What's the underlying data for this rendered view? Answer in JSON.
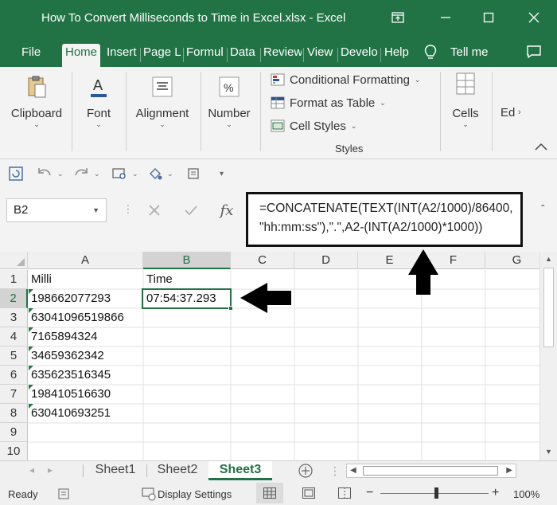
{
  "window": {
    "title": "How To Convert Milliseconds to Time in Excel.xlsx  -  Excel"
  },
  "menu": {
    "tabs": [
      "File",
      "Home",
      "Insert",
      "Page La",
      "Formul",
      "Data",
      "Review",
      "View",
      "Develo",
      "Help"
    ],
    "tell_me": "Tell me"
  },
  "ribbon": {
    "clipboard": "Clipboard",
    "font": "Font",
    "alignment": "Alignment",
    "number": "Number",
    "conditional_formatting": "Conditional Formatting",
    "format_as_table": "Format as Table",
    "cell_styles": "Cell Styles",
    "styles": "Styles",
    "cells": "Cells",
    "editing": "Ed"
  },
  "formula_bar": {
    "name_box": "B2",
    "fx": "fx",
    "formula_line1": "=CONCATENATE(TEXT(INT(A2/1000)/86400,",
    "formula_line2": "\"hh:mm:ss\"),\".\",A2-(INT(A2/1000)*1000))"
  },
  "grid": {
    "columns": [
      "A",
      "B",
      "C",
      "D",
      "E",
      "F",
      "G"
    ],
    "rows": [
      "1",
      "2",
      "3",
      "4",
      "5",
      "6",
      "7",
      "8",
      "9",
      "10"
    ],
    "cells": {
      "A1": "Milli",
      "B1": "Time",
      "A2": "198662077293",
      "B2": "07:54:37.293",
      "A3": "63041096519866",
      "A4": "7165894324",
      "A5": "34659362342",
      "A6": "635623516345",
      "A7": "198410516630",
      "A8": "630410693251"
    }
  },
  "sheets": {
    "tabs": [
      "Sheet1",
      "Sheet2",
      "Sheet3"
    ],
    "active": "Sheet3"
  },
  "status": {
    "ready": "Ready",
    "display_settings": "Display Settings",
    "zoom": "100%"
  },
  "colors": {
    "accent": "#217346"
  }
}
